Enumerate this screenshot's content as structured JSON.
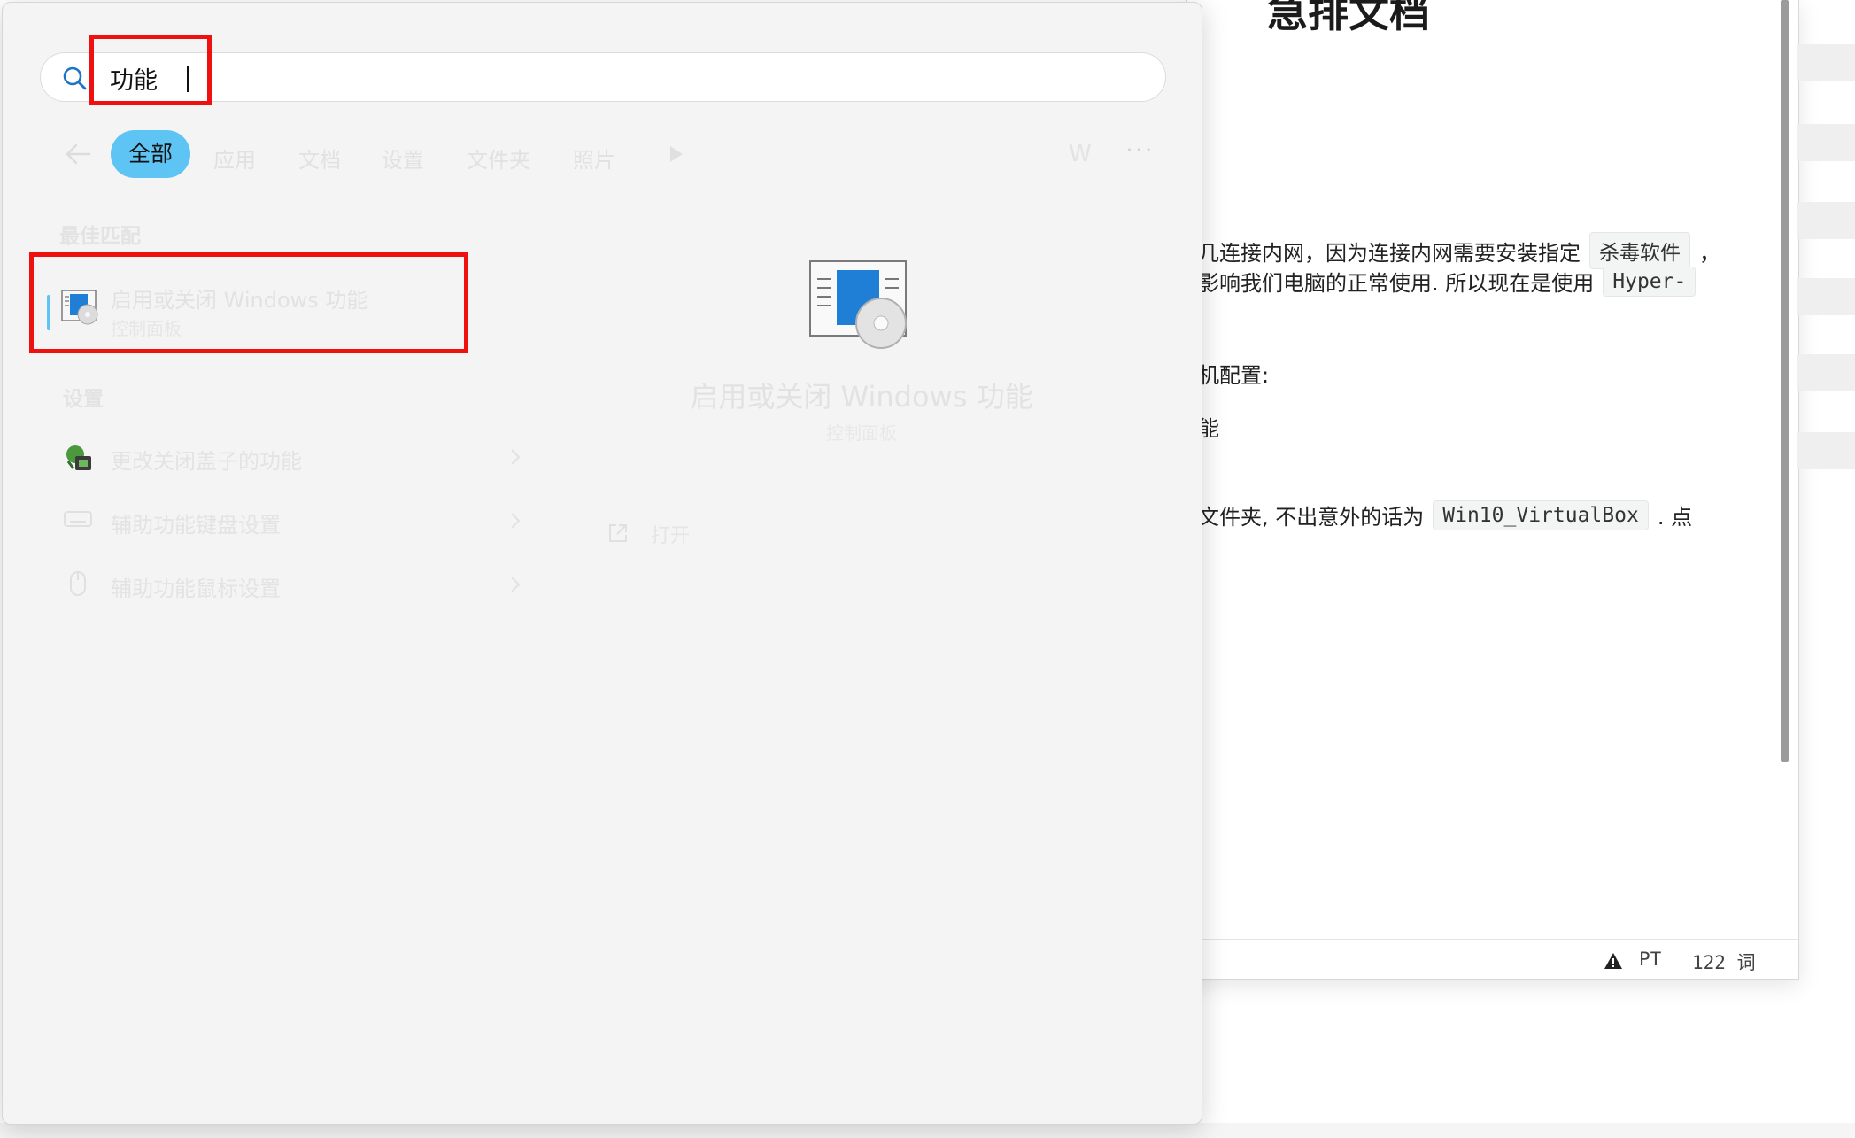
{
  "search": {
    "query": "功能"
  },
  "filters": {
    "active": "全部",
    "tabs": [
      "应用",
      "文档",
      "设置",
      "文件夹",
      "照片"
    ],
    "extra_letter": "W",
    "more": "···"
  },
  "best_match": {
    "heading": "最佳匹配",
    "title": "启用或关闭 Windows 功能",
    "subtitle": "控制面板"
  },
  "settings": {
    "heading": "设置",
    "items": [
      {
        "label": "更改关闭盖子的功能"
      },
      {
        "label": "辅助功能键盘设置"
      },
      {
        "label": "辅助功能鼠标设置"
      }
    ]
  },
  "detail": {
    "title": "启用或关闭 Windows 功能",
    "subtitle": "控制面板",
    "open_label": "打开"
  },
  "document": {
    "title": "急排文档",
    "line1_text": "几连接内网，因为连接内网需要安装指定",
    "line1_code": "杀毒软件",
    "line1_tail": "，",
    "line2_text": "影响我们电脑的正常使用. 所以现在是使用",
    "line2_code": "Hyper-",
    "line3_text": "机配置:",
    "line4_text": "能",
    "line5_text": "文件夹, 不出意外的话为",
    "line5_code": "Win10_VirtualBox",
    "line5_tail": ". 点",
    "status_lang": "PT",
    "status_words": "122 词"
  },
  "colors": {
    "accent": "#5ec4f3",
    "highlight_box": "#ef1010"
  }
}
